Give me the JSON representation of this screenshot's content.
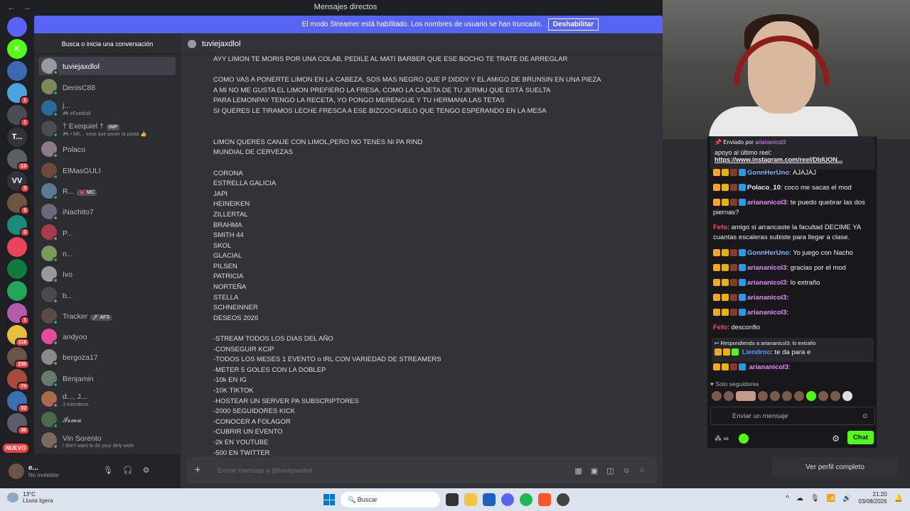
{
  "window": {
    "title": "Mensajes directos"
  },
  "banner": {
    "text": "El modo Streamer está habilitado. Los nombres de usuario se han truncado.",
    "button": "Deshabilitar"
  },
  "servers": {
    "items": [
      {
        "label": "",
        "color": "#5865f2",
        "badge": ""
      },
      {
        "label": "K",
        "color": "#53fc18",
        "badge": ""
      },
      {
        "label": "",
        "color": "#3b6ab0",
        "badge": ""
      },
      {
        "label": "",
        "color": "#4aa3df",
        "badge": "1"
      },
      {
        "label": "",
        "color": "#4a4d52",
        "badge": "1"
      },
      {
        "label": "T...",
        "color": "#313338",
        "badge": ""
      },
      {
        "label": "",
        "color": "#5a5e66",
        "badge": "13"
      },
      {
        "label": "VV",
        "color": "#313338",
        "badge": "3"
      },
      {
        "label": "",
        "color": "#6b5442",
        "badge": "3"
      },
      {
        "label": "",
        "color": "#1a8a7a",
        "badge": "3"
      },
      {
        "label": "",
        "color": "#e8455d",
        "badge": ""
      },
      {
        "label": "",
        "color": "#0f7a3b",
        "badge": ""
      },
      {
        "label": "",
        "color": "#23a55a",
        "badge": ""
      },
      {
        "label": "",
        "color": "#b35aa8",
        "badge": "1"
      },
      {
        "label": "",
        "color": "#e8c13a",
        "badge": "118"
      },
      {
        "label": "",
        "color": "#6a5446",
        "badge": "230"
      },
      {
        "label": "",
        "color": "#a84a3a",
        "badge": "74"
      },
      {
        "label": "",
        "color": "#3a6fb0",
        "badge": "32"
      },
      {
        "label": "",
        "color": "#5a5e66",
        "badge": "36"
      }
    ],
    "new_label": "NUEVO"
  },
  "dm": {
    "search_placeholder": "Busca o inicia una conversación",
    "items": [
      {
        "name": "tuviejaxdlol",
        "sub": "",
        "tag": "",
        "color": "#949ba4",
        "online": false,
        "selected": true
      },
      {
        "name": "DenisC88",
        "sub": "",
        "tag": "",
        "color": "#7a8a5a",
        "online": true,
        "selected": false
      },
      {
        "name": "j...",
        "sub": "🎮 eFootball",
        "tag": "",
        "color": "#2a6a9a",
        "online": true,
        "selected": false
      },
      {
        "name": "† Exequiel †",
        "sub": "🎮 • Mh... nose que poner la posta 👍",
        "tag": "IMP",
        "color": "#4a4d52",
        "online": true,
        "selected": false
      },
      {
        "name": "Polaco",
        "sub": "",
        "tag": "",
        "color": "#8a7a8a",
        "online": false,
        "selected": false
      },
      {
        "name": "ElMasGULI",
        "sub": "",
        "tag": "",
        "color": "#6a4a3a",
        "online": true,
        "selected": false
      },
      {
        "name": "R...",
        "sub": "",
        "tag": "💗 MC",
        "color": "#5a7a9a",
        "online": true,
        "selected": false
      },
      {
        "name": "iNachito7",
        "sub": "",
        "tag": "",
        "color": "#6a6a7a",
        "online": false,
        "selected": false
      },
      {
        "name": "P...",
        "sub": "",
        "tag": "",
        "color": "#a83a4a",
        "online": false,
        "selected": false
      },
      {
        "name": "n...",
        "sub": "",
        "tag": "",
        "color": "#7a9a5a",
        "online": true,
        "selected": false
      },
      {
        "name": "Ivo",
        "sub": "",
        "tag": "",
        "color": "#9a9a9a",
        "online": false,
        "selected": false
      },
      {
        "name": "b...",
        "sub": "",
        "tag": "",
        "color": "#4a4a4a",
        "online": false,
        "selected": false
      },
      {
        "name": "Tracker",
        "sub": "",
        "tag": "🚀 AFS",
        "color": "#5a4a4a",
        "online": true,
        "selected": false
      },
      {
        "name": "andyoo",
        "sub": "",
        "tag": "",
        "color": "#e84a9a",
        "online": false,
        "selected": false
      },
      {
        "name": "bergoza17",
        "sub": "",
        "tag": "",
        "color": "#8a8a8a",
        "online": false,
        "selected": false
      },
      {
        "name": "Benjamin",
        "sub": "",
        "tag": "",
        "color": "#6a7a6a",
        "online": true,
        "selected": false
      },
      {
        "name": "d..., J...",
        "sub": "3 miembros",
        "tag": "",
        "color": "#a86a4a",
        "online": false,
        "selected": false
      },
      {
        "name": "𝓘𝓼𝓶𝓪",
        "sub": "",
        "tag": "",
        "color": "#4a6a4a",
        "online": true,
        "selected": false
      },
      {
        "name": "Vin Sorento",
        "sub": "I don't want to do your dirty work",
        "tag": "",
        "color": "#7a6a5a",
        "online": false,
        "selected": false
      }
    ]
  },
  "user": {
    "name": "e...",
    "status": "No molestar"
  },
  "channel": {
    "name": "tuviejaxdlol",
    "composer_placeholder": "Enviar mensaje a @tuviejaxdlol"
  },
  "messages": [
    "AYY LIMON TE MORIS POR UNA COLAB, PEDILE AL MATI BARBER QUE ESE BOCHO TE TRATE DE ARREGLAR",
    "",
    "COMO VAS A PONERTE LIMON EN LA CABEZA, SOS MAS NEGRO QUE P DIDDY Y EL AMIGO DE BRUNSIN EN UNA PIEZA",
    "A MI NO ME GUSTA EL LIMON PREFIERO LA FRESA, COMO LA CAJETA DE TU JERMU QUE ESTÁ SUELTA",
    "PARA LEMONPAY TENGO LA RECETA, YO PONGO MERENGUE Y TU HERMANA LAS TETAS",
    "SI QUERES LE TIRAMOS LECHE FRESCA A ESE BIZCOCHUELO QUE TENGO ESPERANDO EN LA MESA",
    "",
    "",
    "LIMON QUERES CANJE CON LIMOL,PERO NO TENES NI PA RIND",
    "MUNDIAL DE CERVEZAS",
    "",
    "CORONA",
    "ESTRELLA GALICIA",
    "JAPI",
    "HEINEIKEN",
    "ZILLERTAL",
    "BRAHMA",
    "SMITH 44",
    "SKOL",
    "GLACIAL",
    "PILSEN",
    "PATRICIA",
    "NORTEÑA",
    "STELLA",
    "SCHNEINNER",
    "DESEOS 2026",
    "",
    "-STREAM TODOS LOS DIAS DEL AÑO",
    "-CONSEGUIR KCIP",
    "-TODOS LOS MESES 1 EVENTO o IRL CON VARIEDAD DE STREAMERS",
    "-METER 5 GOLES CON LA DOBLEP",
    "-10k EN IG",
    "-10K TIKTOK",
    "-HOSTEAR UN SERVER PA SUBSCRIPTORES",
    "-2000 SEGUIDORES KICK",
    "-CONOCER A FOLAGOR",
    "-CUBRIR UN EVENTO",
    "-2k EN YOUTUBE",
    "-500 EN TWITTER"
  ],
  "chat": {
    "pinned_by": "Enviado por",
    "pinned_user": "ariananicol3",
    "pinned_text": "apoyo al último reel:",
    "pinned_link": "https://www.instagram.com/reel/DbIUON...",
    "lines": [
      {
        "user": "GonnHerUno",
        "color": "#7ab8ff",
        "text": ": AJAJAJ"
      },
      {
        "user": "Polaco_10",
        "color": "#efeff1",
        "text": ": coco me sacas el mod"
      },
      {
        "user": "ariananicol3",
        "color": "#e88aff",
        "text": ": te puedo quebrar las dos piernas?"
      },
      {
        "user": "Fefo",
        "color": "#ff4a6a",
        "text": ": amigo si arrancaste la facultad DECIME YA cuantas escaleras subiste para llegar a clase."
      },
      {
        "user": "GonnHerUno",
        "color": "#7ab8ff",
        "text": ": Yo juego con Nacho"
      },
      {
        "user": "ariananicol3",
        "color": "#e88aff",
        "text": ": gracias por el mod"
      },
      {
        "user": "ariananicol3",
        "color": "#e88aff",
        "text": ": lo extraño"
      },
      {
        "user": "ariananicol3",
        "color": "#e88aff",
        "text": ":"
      },
      {
        "user": "ariananicol3",
        "color": "#e88aff",
        "text": ":"
      },
      {
        "user": "Fefo",
        "color": "#ff4a6a",
        "text": ": desconfio"
      }
    ],
    "reply_header": "Respondiendo a ariananicol3: lo extraño",
    "reply_user": "Liendroo",
    "reply_text": ": te da para e",
    "last_user": "ariananicol3",
    "last_text": ":",
    "followers_label": "Solo seguidores",
    "input_placeholder": "Enviar un mensaje",
    "chat_button": "Chat"
  },
  "profile_button": "Ver perfil completo",
  "taskbar": {
    "temp": "13°C",
    "weather": "Lluvia ligera",
    "search": "Buscar",
    "time": "21:20",
    "date": "03/08/2026"
  }
}
